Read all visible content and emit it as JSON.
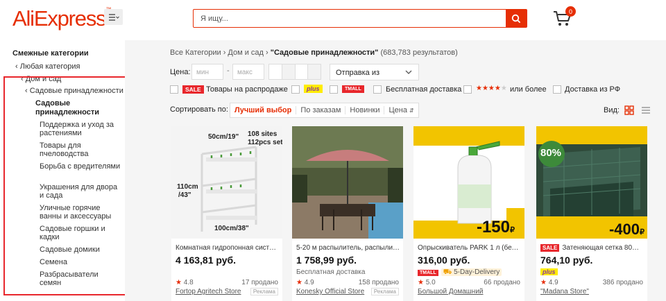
{
  "header": {
    "logo": "AliExpress",
    "search_placeholder": "Я ищу...",
    "cart_count": "0"
  },
  "sidebar": {
    "title": "Смежные категории",
    "any_category": "Любая категория",
    "level1": "Дом и сад",
    "level2": "Садовые принадлежности",
    "current": "Садовые принадлежности",
    "subcategories": [
      "Поддержка и уход за растениями",
      "Товары для пчеловодства",
      "Борьба с вредителями",
      "Украшения для двора и сада",
      "Уличные горячие ванны и аксессуары",
      "Садовые горшки и кадки",
      "Садовые домики",
      "Семена",
      "Разбрасыватели семян"
    ]
  },
  "breadcrumb": {
    "root": "Все Категории",
    "parent": "Дом и сад",
    "current": "\"Садовые принадлежности\"",
    "count": "(683,783 результатов)"
  },
  "filters": {
    "price_label": "Цена:",
    "min_placeholder": "мин",
    "max_placeholder": "макс",
    "ship_from": "Отправка из",
    "sale_badge": "SALE",
    "sale_label": "Товары на распродаже",
    "plus_badge": "plus",
    "tmall_badge": "TMALL",
    "free_shipping": "Бесплатная доставка",
    "rating_label": "или более",
    "ship_rf": "Доставка из РФ"
  },
  "sort": {
    "label": "Сортировать по:",
    "options": [
      "Лучший выбор",
      "По заказам",
      "Новинки",
      "Цена"
    ],
    "view_label": "Вид:"
  },
  "products": [
    {
      "title": "Комнатная гидропонная систем...",
      "price": "4 163,81 руб.",
      "rating": "4.8",
      "sold": "17 продано",
      "store": "Fortop Agritech Store",
      "ad": "Реклама",
      "image_text": [
        "50cm/19\"",
        "108 sites",
        "112pcs set",
        "110cm",
        "/43\"",
        "100cm/38\""
      ]
    },
    {
      "title": "5-20 м распылитель, распылите...",
      "price": "1 758,99 руб.",
      "shipping": "Бесплатная доставка",
      "rating": "4.9",
      "sold": "158 продано",
      "store": "Konesky Official Store",
      "ad": "Реклама"
    },
    {
      "title": "Опрыскиватель PARK 1 л (белый,...",
      "price": "316,00 руб.",
      "tmall": "TMALL",
      "delivery": "5-Day-Delivery",
      "rating": "5.0",
      "sold": "66 продано",
      "store": "Большой Домашний",
      "image_discount": "-150",
      "image_currency": "₽"
    },
    {
      "title": "Затеняющая сетка 80% ф...",
      "sale": "SALE",
      "price": "764,10 руб.",
      "plus": "plus",
      "rating": "4.9",
      "sold": "386 продано",
      "store": "\"Madana Store\"",
      "image_badge": "80%",
      "image_discount": "-400",
      "image_currency": "₽"
    }
  ],
  "colors": {
    "brand": "#e62e04",
    "highlight_box": "#e8272c",
    "plus_yellow": "#ffec00"
  }
}
